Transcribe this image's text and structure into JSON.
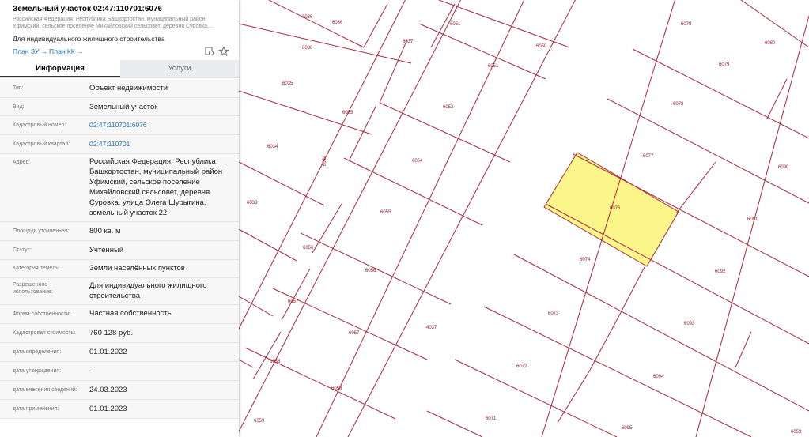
{
  "parcel": {
    "title": "Земельный участок 02:47:110701:6076",
    "address_short": "Российская Федерация, Республика Башкортостан, муниципальный район Уфимский, сельское поселение Михайловский сельсовет, деревня Суровка,...",
    "purpose": "Для индивидуального жилищного строительства",
    "plan_zu": "План ЗУ →",
    "plan_kk": "План КК →"
  },
  "tabs": {
    "info": "Информация",
    "services": "Услуги"
  },
  "fields": [
    {
      "label": "Тип:",
      "value": "Объект недвижимости"
    },
    {
      "label": "Вид:",
      "value": "Земельный участок"
    },
    {
      "label": "Кадастровый номер:",
      "value": "02:47:110701:6076"
    },
    {
      "label": "Кадастровый квартал:",
      "value": "02:47:110701"
    },
    {
      "label": "Адрес:",
      "value": "Российская Федерация, Республика Башкортостан, муниципальный район Уфимский, сельское поселение Михайловский сельсовет, деревня Суровка, улица Олега Шурыгина, земельный участок 22"
    },
    {
      "label": "Площадь уточненная:",
      "value": "800 кв. м"
    },
    {
      "label": "Статус:",
      "value": "Учтенный"
    },
    {
      "label": "Категория земель:",
      "value": "Земли населённых пунктов"
    },
    {
      "label": "Разрешенное использование:",
      "value": "Для индивидуального жилищного строительства"
    },
    {
      "label": "Форма собственности:",
      "value": "Частная собственность"
    },
    {
      "label": "Кадастровая стоимость:",
      "value": "760 128 руб."
    },
    {
      "label": "дата определения:",
      "value": "01.01.2022"
    },
    {
      "label": "дата утверждения:",
      "value": "-"
    },
    {
      "label": "дата внесения сведений:",
      "value": "24.03.2023"
    },
    {
      "label": "дата применения:",
      "value": "01.01.2023"
    }
  ],
  "map": {
    "selected": "6076",
    "labels": [
      "6036",
      "6036",
      "6036",
      "6037",
      "6051",
      "6051",
      "6050",
      "6079",
      "6080",
      "6079",
      "6035",
      "6035",
      "6052",
      "6078",
      "6034",
      "6034",
      "6054",
      "6077",
      "6090",
      "6033",
      "6055",
      "6076",
      "6091",
      "6056",
      "6056",
      "6074",
      "6092",
      "6057",
      "6057",
      "4037",
      "6073",
      "6093",
      "6058",
      "6058",
      "6072",
      "6094",
      "6059",
      "6071",
      "6095",
      "6059"
    ],
    "colors": {
      "parcel_line": "#a8283a",
      "selected_fill": "#fbf58a",
      "label": "#8a1a28",
      "link": "#1f6fb5"
    }
  }
}
